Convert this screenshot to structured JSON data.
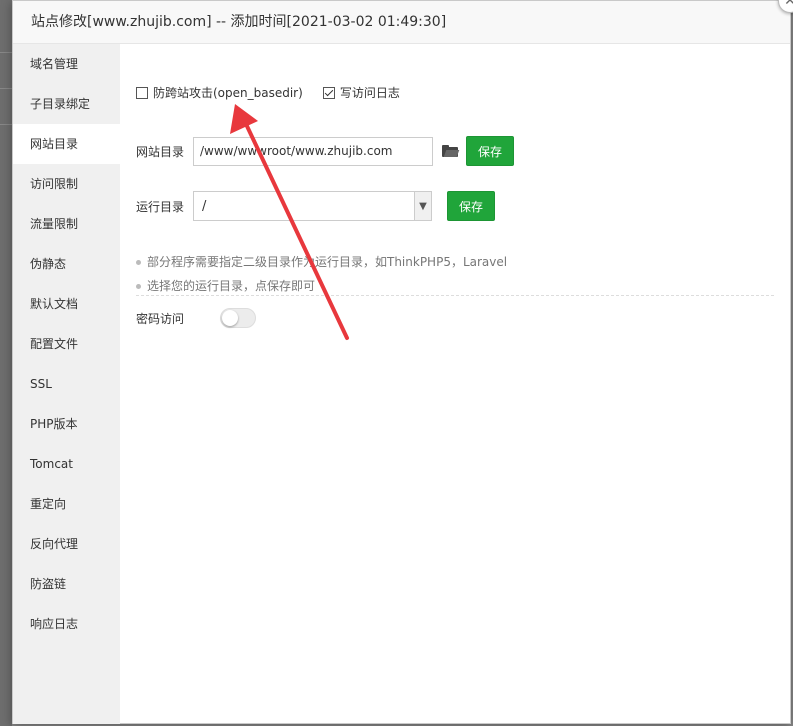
{
  "dialog": {
    "title": "站点修改[www.zhujib.com] -- 添加时间[2021-03-02 01:49:30]",
    "close_glyph": "✕"
  },
  "sidebar": {
    "items": [
      {
        "label": "域名管理",
        "active": false
      },
      {
        "label": "子目录绑定",
        "active": false
      },
      {
        "label": "网站目录",
        "active": true
      },
      {
        "label": "访问限制",
        "active": false
      },
      {
        "label": "流量限制",
        "active": false
      },
      {
        "label": "伪静态",
        "active": false
      },
      {
        "label": "默认文档",
        "active": false
      },
      {
        "label": "配置文件",
        "active": false
      },
      {
        "label": "SSL",
        "active": false
      },
      {
        "label": "PHP版本",
        "active": false
      },
      {
        "label": "Tomcat",
        "active": false
      },
      {
        "label": "重定向",
        "active": false
      },
      {
        "label": "反向代理",
        "active": false
      },
      {
        "label": "防盗链",
        "active": false
      },
      {
        "label": "响应日志",
        "active": false
      }
    ]
  },
  "options": {
    "open_basedir": {
      "label": "防跨站攻击(open_basedir)",
      "checked": false
    },
    "access_log": {
      "label": "写访问日志",
      "checked": true
    }
  },
  "site_dir": {
    "label": "网站目录",
    "value": "/www/wwwroot/www.zhujib.com",
    "save_label": "保存"
  },
  "run_dir": {
    "label": "运行目录",
    "value": "/",
    "save_label": "保存"
  },
  "tips": [
    "部分程序需要指定二级目录作为运行目录，如ThinkPHP5，Laravel",
    "选择您的运行目录，点保存即可"
  ],
  "password_access": {
    "label": "密码访问",
    "enabled": false
  },
  "colors": {
    "primary_green": "#20a53a",
    "annotation_red": "#e8383d"
  }
}
